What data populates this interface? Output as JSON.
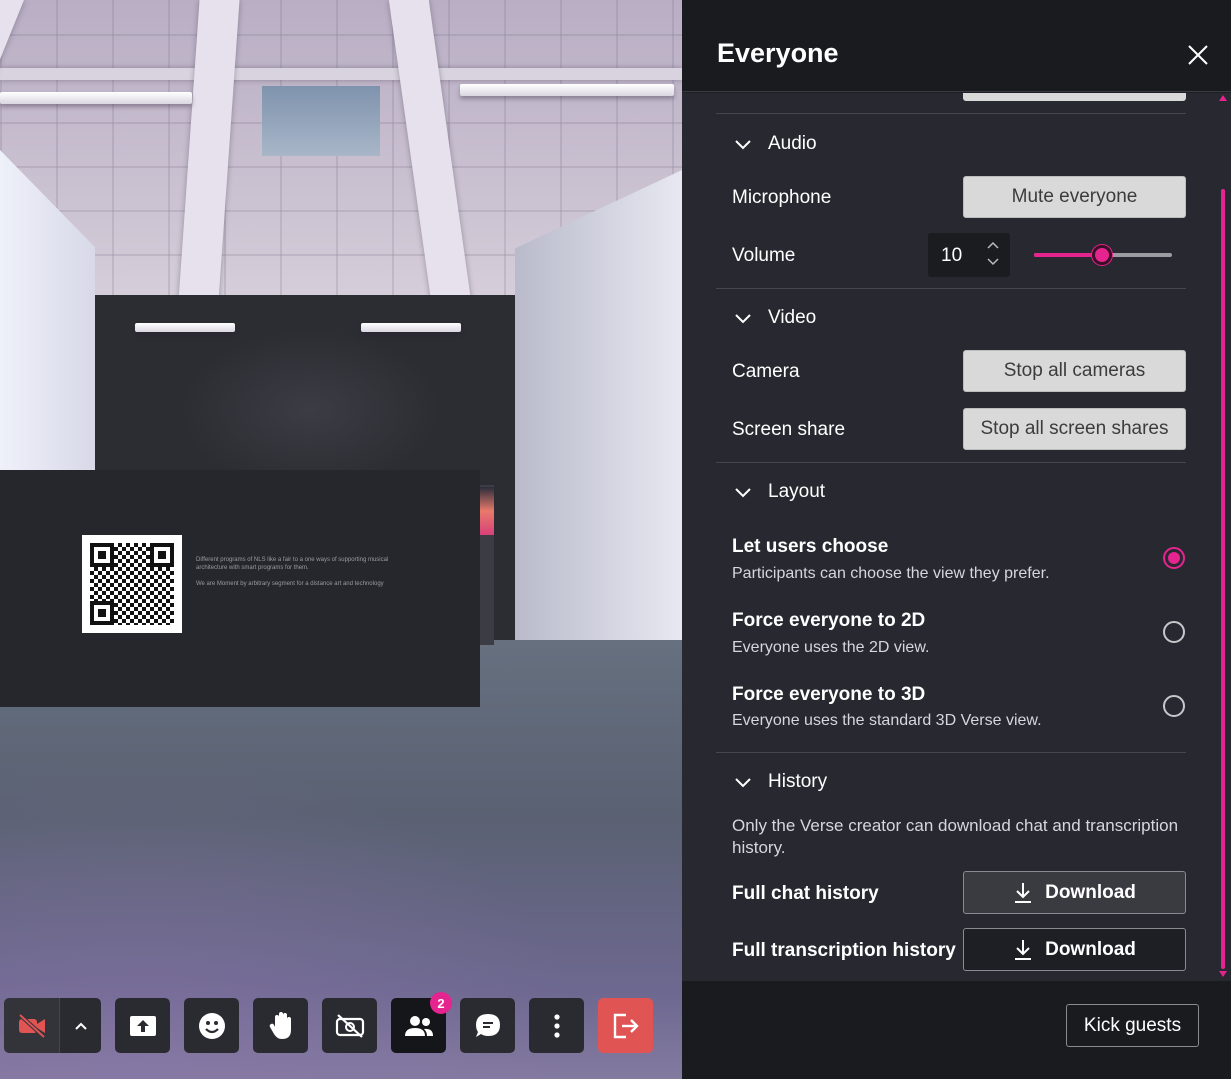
{
  "panel": {
    "title": "Everyone",
    "close_icon": "close-icon",
    "accent_color": "#e6248f",
    "audio": {
      "heading": "Audio",
      "microphone_label": "Microphone",
      "mute_button": "Mute everyone",
      "volume_label": "Volume",
      "volume_value": "10",
      "volume_slider_fraction": 0.49
    },
    "video": {
      "heading": "Video",
      "camera_label": "Camera",
      "stop_cameras_button": "Stop all cameras",
      "screen_share_label": "Screen share",
      "stop_screen_shares_button": "Stop all screen shares"
    },
    "layout": {
      "heading": "Layout",
      "options": [
        {
          "title": "Let users choose",
          "description": "Participants can choose the view they prefer.",
          "selected": true
        },
        {
          "title": "Force everyone to 2D",
          "description": "Everyone uses the 2D view.",
          "selected": false
        },
        {
          "title": "Force everyone to 3D",
          "description": "Everyone uses the standard 3D Verse view.",
          "selected": false
        }
      ]
    },
    "history": {
      "heading": "History",
      "note": "Only the Verse creator can download chat and transcription history.",
      "chat_label": "Full chat history",
      "chat_button": "Download",
      "transcription_label": "Full transcription history",
      "transcription_button": "Download"
    },
    "kick_button": "Kick guests"
  },
  "toolbar": {
    "buttons": [
      {
        "name": "camera-toggle",
        "icon": "video-off-icon"
      },
      {
        "name": "camera-options",
        "icon": "chevron-up-icon"
      },
      {
        "name": "share-screen",
        "icon": "share-up-icon"
      },
      {
        "name": "reactions",
        "icon": "smile-icon"
      },
      {
        "name": "raise-hand",
        "icon": "hand-icon"
      },
      {
        "name": "hide-video",
        "icon": "camera-off-icon"
      },
      {
        "name": "participants",
        "icon": "people-icon",
        "badge": "2"
      },
      {
        "name": "chat",
        "icon": "chat-icon"
      },
      {
        "name": "more",
        "icon": "more-vertical-icon"
      },
      {
        "name": "leave",
        "icon": "leave-icon"
      }
    ],
    "leave_color": "#e05454"
  },
  "scene": {
    "poster_text_1": "Different programs of NLS like a fair to a one ways of supporting musical architecture with smart programs for them.",
    "poster_text_2": "We are Moment by arbitrary segment for a distance art and technology"
  }
}
